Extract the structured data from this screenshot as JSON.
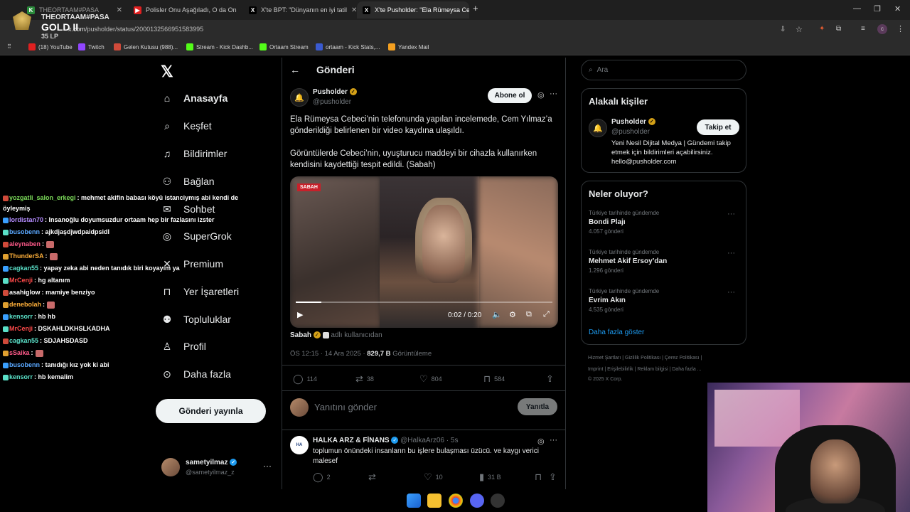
{
  "browser": {
    "tabs": [
      {
        "title": "THEORTAAM#PASA",
        "active": false
      },
      {
        "title": "Polisler Onu Aşağıladı, O da On",
        "active": false
      },
      {
        "title": "X'te BPT: \"Dünyanın en iyi tatil",
        "active": false
      },
      {
        "title": "X'te Pusholder: \"Ela Rümeysa Ce",
        "active": true
      }
    ],
    "new_tab": "+",
    "url_host": "x.com",
    "url_path": "/pusholder/status/2000132566951583995",
    "bookmarks": [
      "(18) YouTube",
      "Twitch",
      "Gelen Kutusu (988)...",
      "Stream - Kick Dashb...",
      "Ortaam Stream",
      "ortaam - Kick Stats,...",
      "Yandex Mail"
    ]
  },
  "overlay": {
    "rank_name": "THEORTAAM#PASA",
    "rank_tier": "GOLD II",
    "rank_lp": "35 LP"
  },
  "nav": {
    "items": [
      "Anasayfa",
      "Keşfet",
      "Bildirimler",
      "Bağlan",
      "Sohbet",
      "SuperGrok",
      "Premium",
      "Yer İşaretleri",
      "Topluluklar",
      "Profil",
      "Daha fazla"
    ],
    "post_button": "Gönderi yayınla",
    "user_name": "sametyilmaz",
    "user_handle": "@sametyilmaz_z"
  },
  "post": {
    "header": "Gönderi",
    "author": "Pusholder",
    "handle": "@pusholder",
    "subscribe": "Abone ol",
    "text1": "Ela Rümeysa Cebeci’nin telefonunda yapılan incelemede, Cem Yılmaz’a gönderildiği belirlenen bir video kaydına ulaşıldı.",
    "text2": "Görüntülerde Cebeci’nin, uyuşturucu maddeyi bir cihazla kullanırken kendisini kaydettiği tespit edildi. (Sabah)",
    "video_badge": "SABAH",
    "video_time": "0:02 / 0:20",
    "video_progress": 0.1,
    "source_name": "Sabah",
    "source_suffix": "adlı kullanıcıdan",
    "time": "ÖS 12:15 · 14 Ara 2025 ·",
    "views": "829,7 B",
    "views_label": "Görüntüleme",
    "stats": {
      "replies": "114",
      "reposts": "38",
      "likes": "804",
      "bookmarks": "584"
    },
    "reply_placeholder": "Yanıtını gönder",
    "reply_button": "Yanıtla"
  },
  "reply": {
    "author": "HALKA ARZ & FİNANS",
    "handle": "@HalkaArz06 · 5s",
    "text": "toplumun önündeki insanların bu işlere bulaşması üzücü. ve kaygı verici malesef",
    "replies": "2",
    "likes": "10",
    "views": "31 B"
  },
  "sidebar": {
    "search_placeholder": "Ara",
    "related_title": "Alakalı kişiler",
    "related_name": "Pusholder",
    "related_handle": "@pusholder",
    "follow": "Takip et",
    "related_bio": "Yeni Nesil Dijital Medya | Gündemi takip etmek için bildirimleri açabilirsiniz. hello@pusholder.com",
    "trends_title": "Neler oluyor?",
    "trends": [
      {
        "category": "Türkiye tarihinde gündemde",
        "name": "Bondi Plajı",
        "count": "4.057 gönderi"
      },
      {
        "category": "Türkiye tarihinde gündemde",
        "name": "Mehmet Akif Ersoy’dan",
        "count": "1.296 gönderi"
      },
      {
        "category": "Türkiye tarihinde gündemde",
        "name": "Evrim Akın",
        "count": "4.535 gönderi"
      }
    ],
    "show_more": "Daha fazla göster",
    "footer1": "Hizmet Şartları  |  Gizlilik Politikası  |  Çerez Politikası  |",
    "footer2": "Imprint  |  Erişilebilirlik  |  Reklam bilgisi  |  Daha fazla ...",
    "footer3": "© 2025 X Corp."
  },
  "chat": [
    {
      "user": "yozgatli_salon_erkegi",
      "msg": ": mehmet akifin babası köyü istanciymış abi kendi de",
      "color": "#7cdc5a"
    },
    {
      "user": "",
      "msg": "öyleymiş",
      "color": "#ffffff"
    },
    {
      "user": "lordistan70",
      "msg": ": Insanoğlu doyumsuzdur ortaam hep bir fazlasını izster",
      "color": "#b48cff"
    },
    {
      "user": "busobenn",
      "msg": ": ajkdjaşdjwdpaidpsidl",
      "color": "#5aa8ff"
    },
    {
      "user": "aleynaben",
      "msg": ":",
      "color": "#ff5a8a"
    },
    {
      "user": "ThunderSA",
      "msg": ":",
      "color": "#ffb03a"
    },
    {
      "user": "cagkan55",
      "msg": ": yapay zeka abi neden tanıdık biri koyayım ya",
      "color": "#5ae0c8"
    },
    {
      "user": "MrCenji",
      "msg": ": hg altanım",
      "color": "#ff4a4a"
    },
    {
      "user": "asahiglow",
      "msg": ": mamiye benziyo",
      "color": "#ffffff"
    },
    {
      "user": "denebolah",
      "msg": ":",
      "color": "#ffb03a"
    },
    {
      "user": "kensorr",
      "msg": ": hb hb",
      "color": "#5ae0c8"
    },
    {
      "user": "MrCenji",
      "msg": ": DSKAHLDKHSLKADHA",
      "color": "#ff4a4a"
    },
    {
      "user": "cagkan55",
      "msg": ": SDJAHSDASD",
      "color": "#5ae0c8"
    },
    {
      "user": "sSaika",
      "msg": ":",
      "color": "#ff5a8a"
    },
    {
      "user": "busobenn",
      "msg": ": tanıdığı kız yok ki abi",
      "color": "#5aa8ff"
    },
    {
      "user": "kensorr",
      "msg": ": hb kemalim",
      "color": "#5ae0c8"
    }
  ],
  "colors": {
    "accent": "#1d9bf0",
    "gold": "#d4a017",
    "bg": "#000000",
    "text": "#e7e9ea",
    "muted": "#71767b"
  }
}
